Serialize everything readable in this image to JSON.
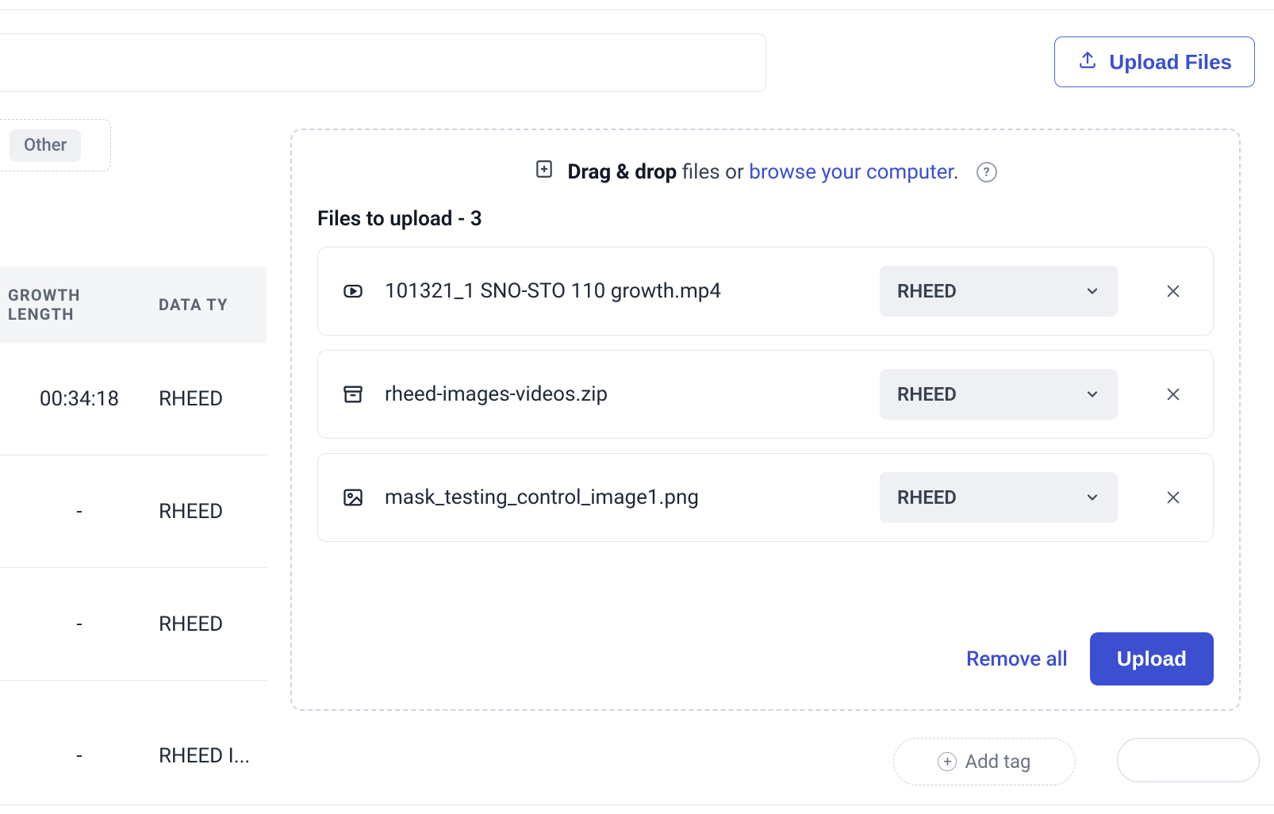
{
  "topbar": {
    "upload_files_label": "Upload Files"
  },
  "filter": {
    "tag_other": "Other"
  },
  "table": {
    "headers": {
      "growth_length": "GROWTH LENGTH",
      "data_type": "DATA TY"
    },
    "rows": [
      {
        "growth": "00:34:18",
        "type": "RHEED"
      },
      {
        "growth": "-",
        "type": "RHEED"
      },
      {
        "growth": "-",
        "type": "RHEED"
      },
      {
        "growth": "-",
        "type": "RHEED"
      }
    ],
    "last_row_type_fragment": "RHEED I..."
  },
  "modal": {
    "drag_drop_strong": "Drag & drop",
    "drag_drop_rest": " files or ",
    "browse_link": "browse your computer",
    "files_to_upload_label": "Files to upload - 3",
    "files": [
      {
        "icon": "video",
        "name": "101321_1 SNO-STO 110 growth.mp4",
        "category": "RHEED"
      },
      {
        "icon": "archive",
        "name": "rheed-images-videos.zip",
        "category": "RHEED"
      },
      {
        "icon": "image",
        "name": "mask_testing_control_image1.png",
        "category": "RHEED"
      }
    ],
    "remove_all_label": "Remove all",
    "upload_label": "Upload"
  },
  "peek": {
    "add_tag_fragment": "Add tag"
  }
}
